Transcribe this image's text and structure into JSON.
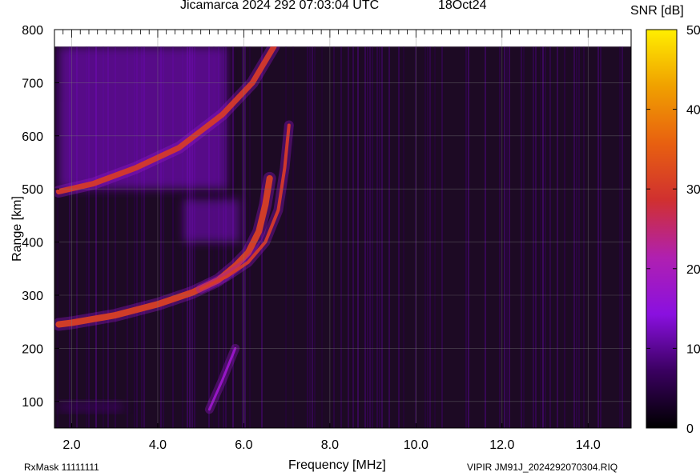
{
  "chart_data": {
    "type": "heatmap",
    "title": "Jicamarca 2024 292 07:03:04 UTC",
    "date_label": "18Oct24",
    "xlabel": "Frequency [MHz]",
    "ylabel": "Range [km]",
    "xlim": [
      1.6,
      15.0
    ],
    "ylim": [
      50,
      800
    ],
    "x_ticks": [
      "2.0",
      "4.0",
      "6.0",
      "8.0",
      "10.0",
      "12.0",
      "14.0"
    ],
    "x_tick_values": [
      2.0,
      4.0,
      6.0,
      8.0,
      10.0,
      12.0,
      14.0
    ],
    "y_ticks": [
      "100",
      "200",
      "300",
      "400",
      "500",
      "600",
      "700",
      "800"
    ],
    "y_tick_values": [
      100,
      200,
      300,
      400,
      500,
      600,
      700,
      800
    ],
    "grid": true,
    "data_top_km": 768,
    "colorbar": {
      "label": "SNR [dB]",
      "range": [
        0,
        50
      ],
      "ticks": [
        "0",
        "10",
        "20",
        "30",
        "40",
        "50"
      ],
      "tick_values": [
        0,
        10,
        20,
        30,
        40,
        50
      ],
      "colors": [
        "#000000",
        "#3a0060",
        "#8a10e0",
        "#b020b0",
        "#d03030",
        "#e86010",
        "#f0a000",
        "#ffee00"
      ]
    },
    "traces": [
      {
        "name": "E-layer O-mode",
        "freq_mhz": [
          1.7,
          2.0,
          3.0,
          4.0,
          4.8,
          5.4,
          5.8,
          6.1,
          6.35,
          6.5,
          6.6
        ],
        "range_km": [
          245,
          248,
          262,
          283,
          305,
          328,
          355,
          380,
          420,
          470,
          520
        ]
      },
      {
        "name": "E-layer X-mode",
        "freq_mhz": [
          5.0,
          5.6,
          6.1,
          6.5,
          6.8,
          6.95,
          7.05
        ],
        "range_km": [
          312,
          335,
          362,
          400,
          460,
          540,
          620
        ]
      },
      {
        "name": "F-layer echo",
        "freq_mhz": [
          1.7,
          2.5,
          3.5,
          4.5,
          5.5,
          6.2,
          6.7
        ],
        "range_km": [
          495,
          510,
          540,
          578,
          640,
          700,
          768
        ]
      },
      {
        "name": "low-range streak",
        "freq_mhz": [
          5.2,
          5.5,
          5.8
        ],
        "range_km": [
          85,
          140,
          200
        ]
      }
    ],
    "patches": [
      {
        "name": "upper diffuse echo",
        "freq_mhz": [
          1.7,
          5.6
        ],
        "range_km": [
          500,
          768
        ],
        "snr_db": 14
      },
      {
        "name": "mid diffuse patch",
        "freq_mhz": [
          4.6,
          5.9
        ],
        "range_km": [
          400,
          480
        ],
        "snr_db": 13
      },
      {
        "name": "low noise band",
        "freq_mhz": [
          1.7,
          3.2
        ],
        "range_km": [
          80,
          100
        ],
        "snr_db": 8
      }
    ]
  },
  "footer": {
    "rxmask": "RxMask 11111111",
    "file": "VIPIR  JM91J_2024292070304.RIQ"
  }
}
